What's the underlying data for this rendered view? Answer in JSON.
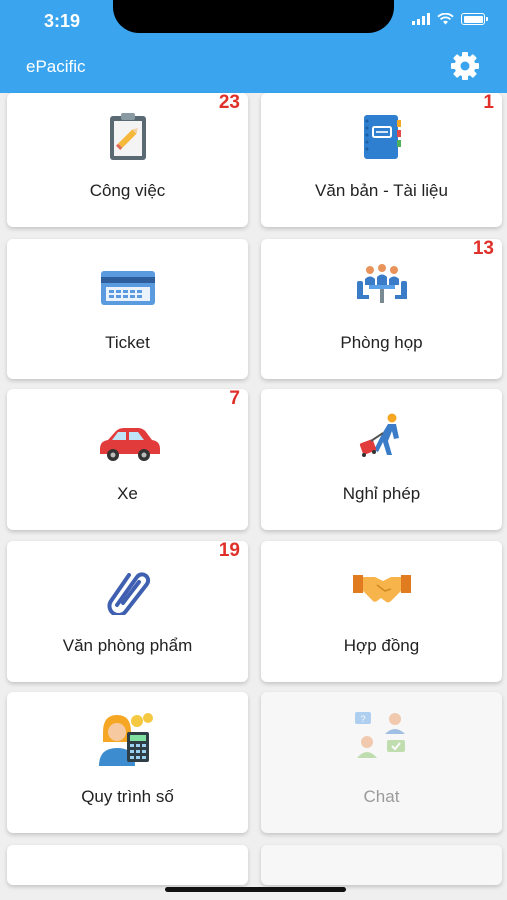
{
  "status_bar": {
    "time": "3:19"
  },
  "header": {
    "title": "ePacific"
  },
  "tiles": [
    {
      "label": "Công việc",
      "badge": "23",
      "icon": "clipboard-pencil-icon"
    },
    {
      "label": "Văn bản - Tài liệu",
      "badge": "1",
      "icon": "notebook-icon"
    },
    {
      "label": "Ticket",
      "badge": "",
      "icon": "ticket-icon"
    },
    {
      "label": "Phòng họp",
      "badge": "13",
      "icon": "meeting-room-icon"
    },
    {
      "label": "Xe",
      "badge": "7",
      "icon": "car-icon"
    },
    {
      "label": "Nghỉ phép",
      "badge": "",
      "icon": "traveler-luggage-icon"
    },
    {
      "label": "Văn phòng phẩm",
      "badge": "19",
      "icon": "paperclip-icon"
    },
    {
      "label": "Hợp đồng",
      "badge": "",
      "icon": "handshake-icon"
    },
    {
      "label": "Quy trình số",
      "badge": "",
      "icon": "calculator-person-icon"
    },
    {
      "label": "Chat",
      "badge": "",
      "icon": "chat-people-icon"
    }
  ]
}
